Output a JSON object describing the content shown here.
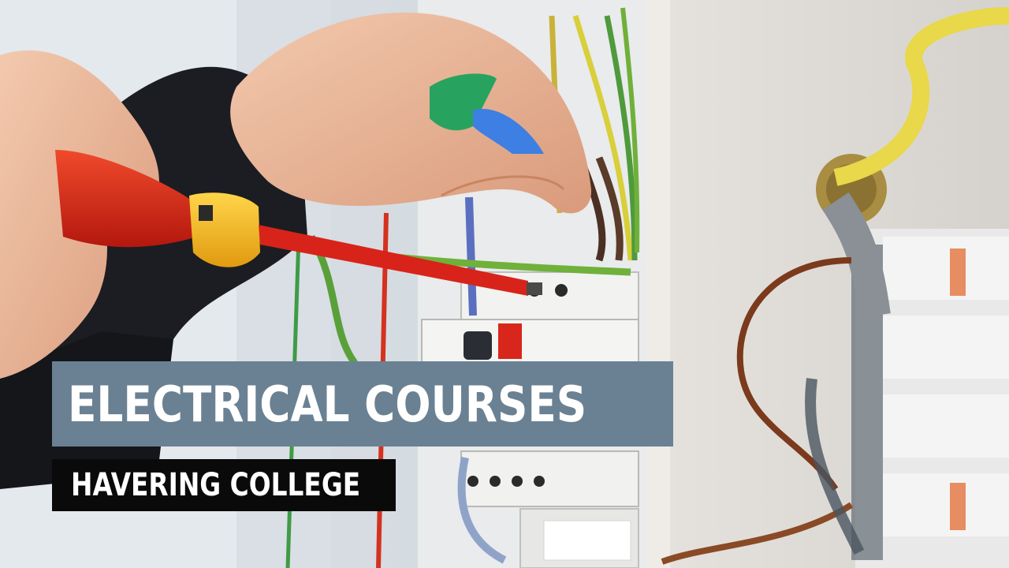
{
  "title_banner": {
    "text": "ELECTRICAL COURSES"
  },
  "subtitle_banner": {
    "text": "HAVERING COLLEGE"
  },
  "colors": {
    "title_banner_bg": "#6a8193",
    "subtitle_banner_bg": "#0a0a0a",
    "text": "#ffffff"
  }
}
